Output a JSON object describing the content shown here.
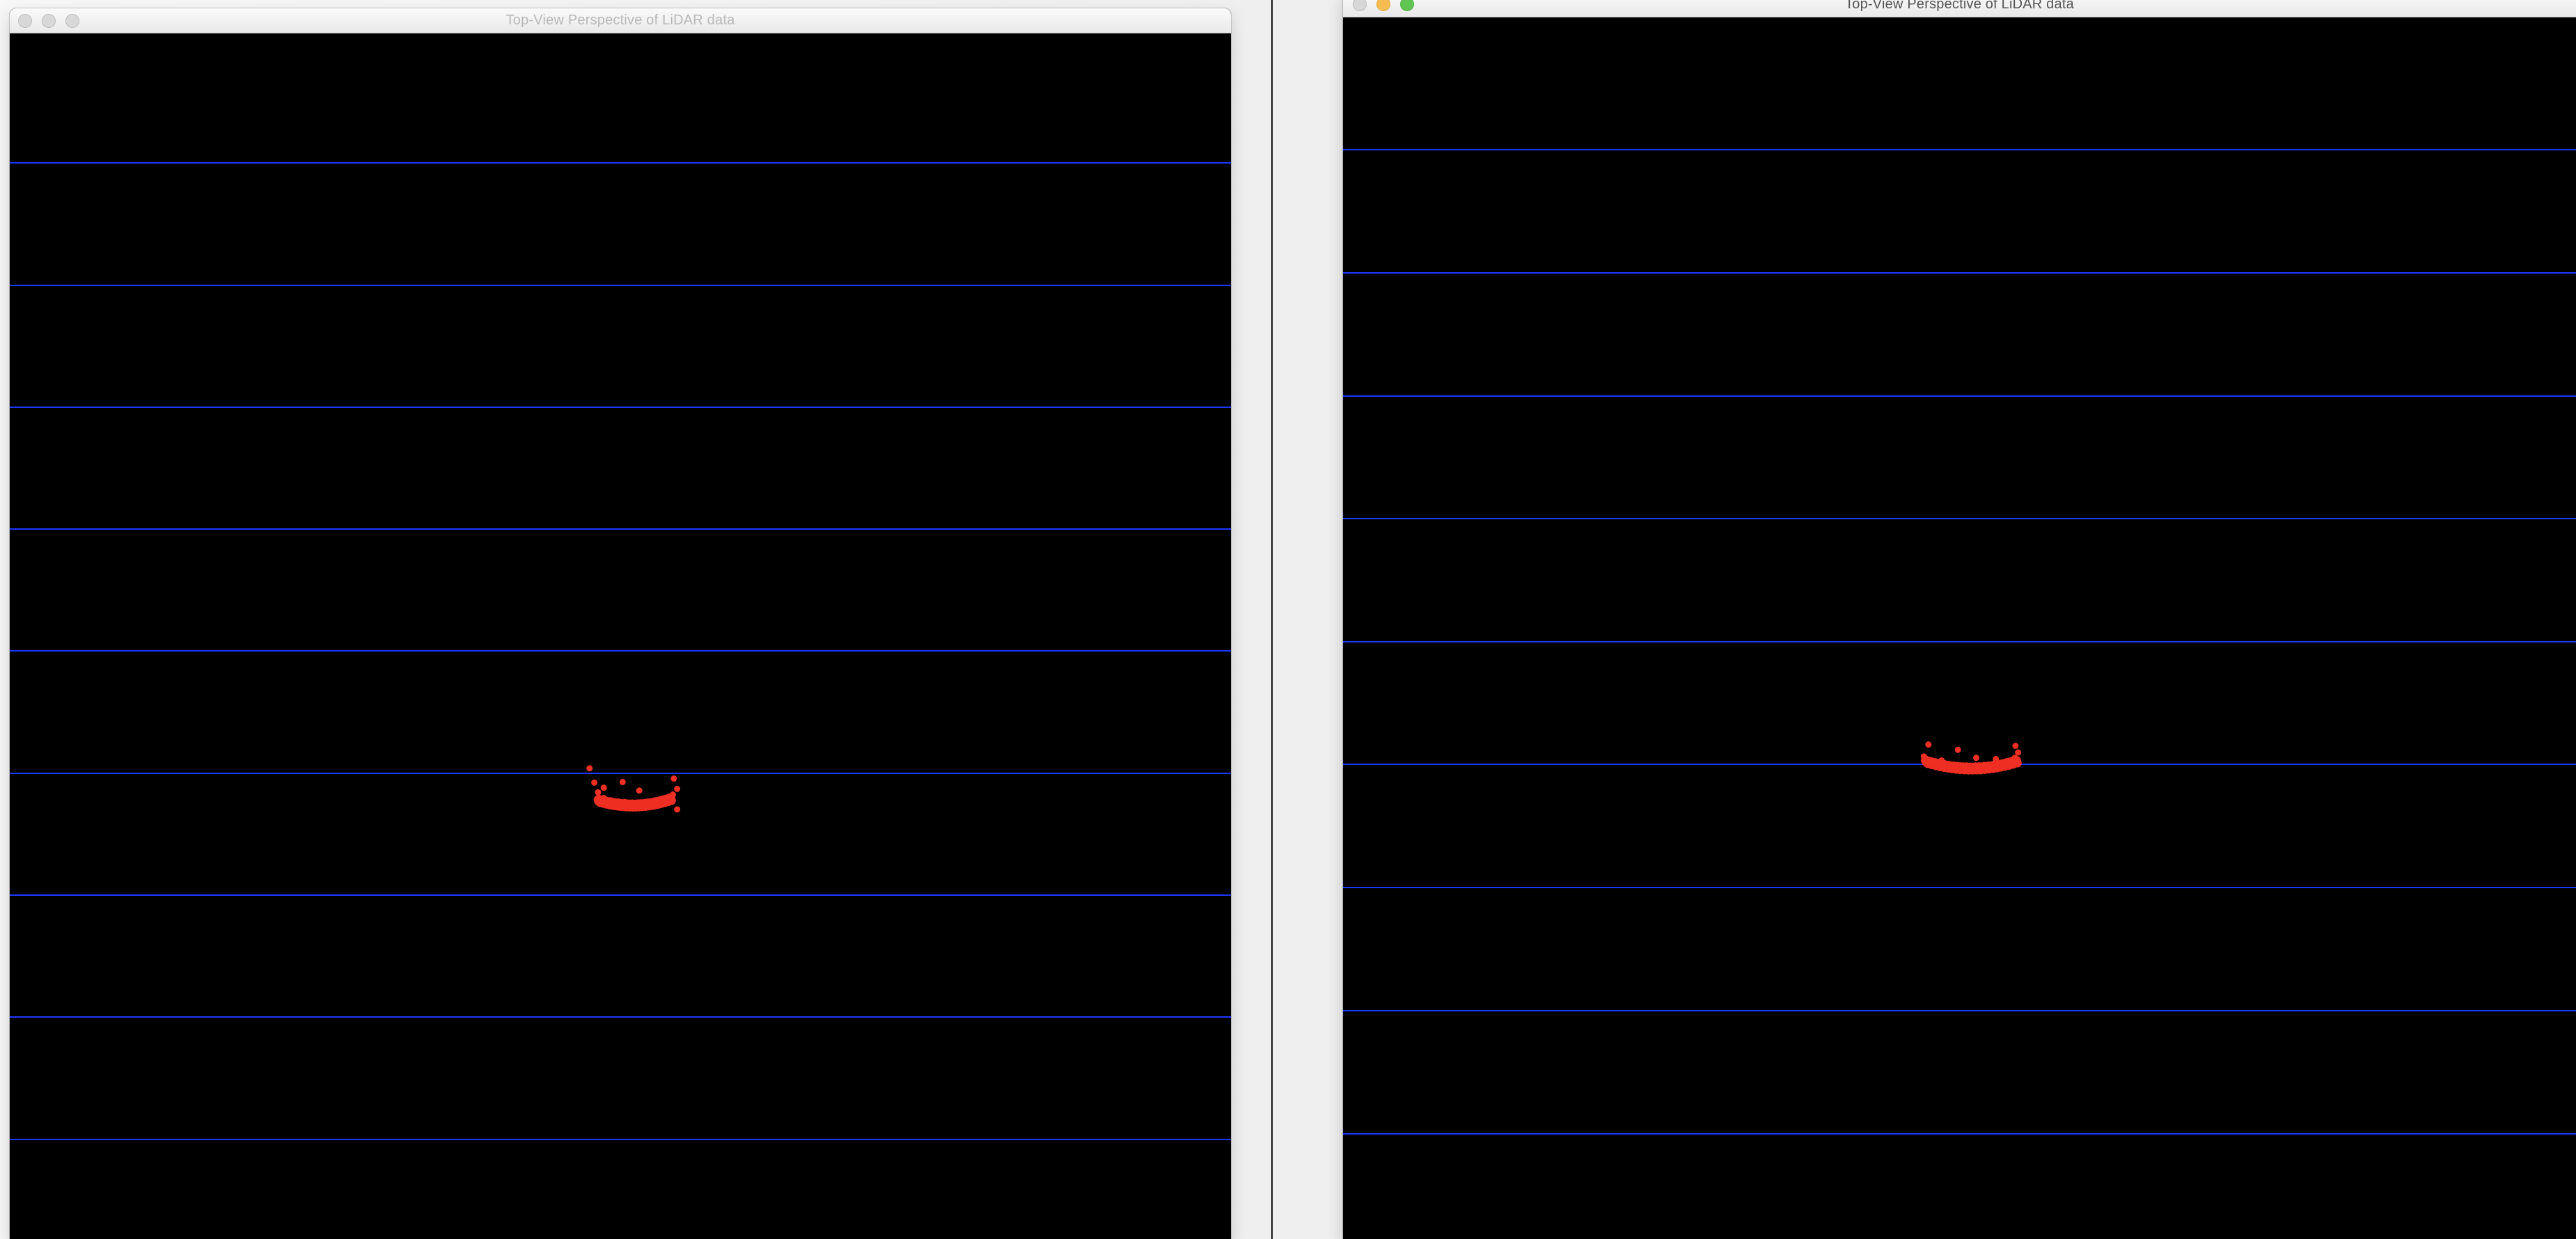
{
  "windows": [
    {
      "title": "Top-View Perspective of LiDAR data",
      "active": false,
      "chart_data": {
        "type": "scatter",
        "series": [
          {
            "color": "#ef2f23",
            "points": [
              [
                -0.9,
                5.8
              ],
              [
                -0.8,
                5.55
              ],
              [
                -0.72,
                5.38
              ],
              [
                -0.6,
                5.28
              ],
              [
                -0.45,
                5.24
              ],
              [
                -0.3,
                5.22
              ],
              [
                -0.15,
                5.21
              ],
              [
                0.0,
                5.2
              ],
              [
                0.15,
                5.2
              ],
              [
                0.3,
                5.21
              ],
              [
                0.45,
                5.22
              ],
              [
                0.6,
                5.24
              ],
              [
                0.75,
                5.28
              ],
              [
                0.86,
                5.34
              ],
              [
                0.95,
                5.44
              ],
              [
                -0.6,
                5.46
              ],
              [
                -0.2,
                5.56
              ],
              [
                0.15,
                5.41
              ],
              [
                0.88,
                5.62
              ],
              [
                0.95,
                5.08
              ]
            ]
          }
        ],
        "grid_color": "#1c37ff",
        "grid": true
      }
    },
    {
      "title": "Top-View Perspective of LiDAR data",
      "active": true,
      "chart_data": {
        "type": "scatter",
        "series": [
          {
            "color": "#ef2f23",
            "points": [
              [
                -0.72,
                5.2
              ],
              [
                -0.68,
                5.15
              ],
              [
                -0.6,
                5.1
              ],
              [
                -0.45,
                5.06
              ],
              [
                -0.3,
                5.04
              ],
              [
                -0.15,
                5.03
              ],
              [
                0.0,
                5.02
              ],
              [
                0.15,
                5.03
              ],
              [
                0.3,
                5.05
              ],
              [
                0.45,
                5.08
              ],
              [
                0.58,
                5.12
              ],
              [
                0.67,
                5.18
              ],
              [
                0.72,
                5.26
              ],
              [
                -0.65,
                5.38
              ],
              [
                -0.45,
                5.14
              ],
              [
                -0.2,
                5.3
              ],
              [
                0.08,
                5.18
              ],
              [
                0.38,
                5.16
              ],
              [
                0.68,
                5.36
              ]
            ]
          }
        ],
        "grid_color": "#1c37ff",
        "grid": true
      }
    }
  ]
}
